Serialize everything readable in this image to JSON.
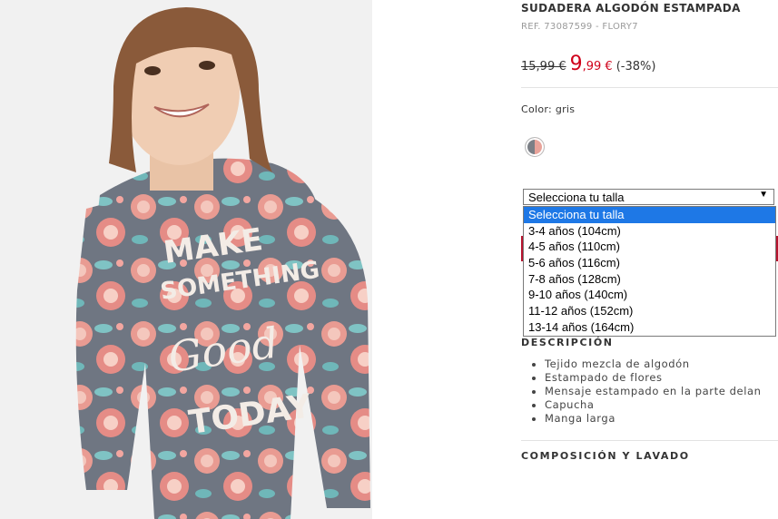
{
  "product": {
    "title": "SUDADERA ALGODÓN ESTAMPADA",
    "ref": "REF. 73087599 - FLORY7",
    "old_price": "15,99 €",
    "new_price_int": "9",
    "new_price_dec": ",99 €",
    "discount": "(-38%)",
    "color_label": "Color: gris",
    "colors": {
      "price_red": "#d0021b",
      "button_red": "#b5132e",
      "highlight": "#1e78e6"
    }
  },
  "photo": {
    "print_lines": [
      "MAKE",
      "SOMETHING",
      "Good",
      "TODAY"
    ]
  },
  "size_select": {
    "selected": "Selecciona tu talla",
    "options": [
      "Selecciona tu talla",
      "3-4 años (104cm)",
      "4-5 años (110cm)",
      "5-6 años (116cm)",
      "7-8 años (128cm)",
      "9-10 años (140cm)",
      "11-12 años (152cm)",
      "13-14 años (164cm)"
    ]
  },
  "description": {
    "heading": "DESCRIPCIÓN",
    "items": [
      "Tejido mezcla de algodón",
      "Estampado de flores",
      "Mensaje estampado en la parte delan",
      "Capucha",
      "Manga larga"
    ]
  },
  "composition": {
    "heading": "COMPOSICIÓN Y LAVADO"
  }
}
